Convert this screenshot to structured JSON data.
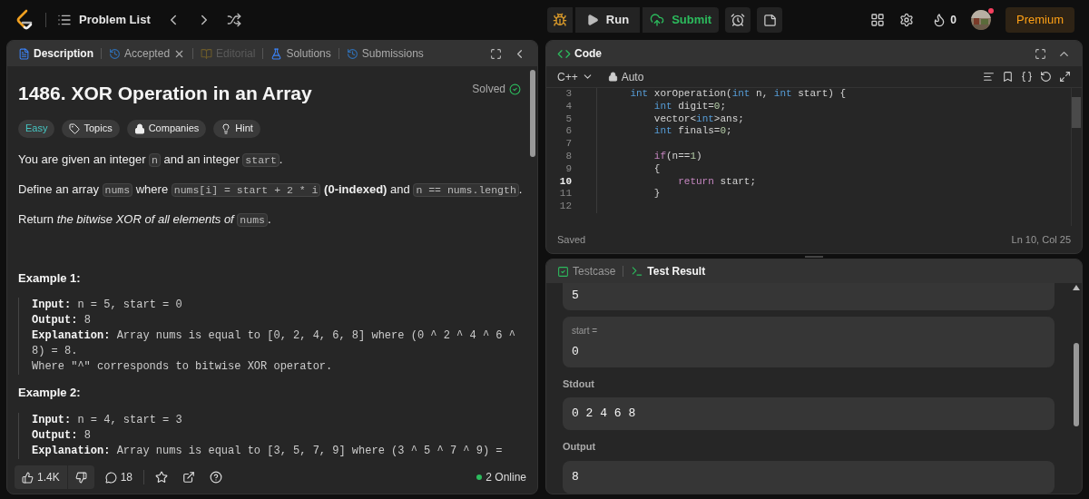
{
  "topbar": {
    "nav_label": "Problem List",
    "run": "Run",
    "submit": "Submit",
    "streak": "0",
    "notification": true,
    "premium": "Premium"
  },
  "left_panel": {
    "tabs": [
      {
        "label": "Description",
        "kind": "description",
        "selected": true,
        "disabled": false,
        "closable": false
      },
      {
        "label": "Accepted",
        "kind": "accepted",
        "selected": false,
        "disabled": false,
        "closable": true
      },
      {
        "label": "Editorial",
        "kind": "editorial",
        "selected": false,
        "disabled": true,
        "closable": false
      },
      {
        "label": "Solutions",
        "kind": "solutions",
        "selected": false,
        "disabled": false,
        "closable": false
      },
      {
        "label": "Submissions",
        "kind": "submissions",
        "selected": false,
        "disabled": false,
        "closable": false
      }
    ],
    "problem": {
      "title": "1486. XOR Operation in an Array",
      "status": "Solved",
      "tags": [
        {
          "kind": "difficulty",
          "label": "Easy"
        },
        {
          "kind": "topics",
          "label": "Topics"
        },
        {
          "kind": "companies",
          "label": "Companies"
        },
        {
          "kind": "hint",
          "label": "Hint"
        }
      ],
      "paragraphs": [
        [
          {
            "kind": "text",
            "text": "You are given an integer "
          },
          {
            "kind": "code",
            "text": "n"
          },
          {
            "kind": "text",
            "text": " and an integer "
          },
          {
            "kind": "code",
            "text": "start"
          },
          {
            "kind": "text",
            "text": "."
          }
        ],
        [
          {
            "kind": "text",
            "text": "Define an array "
          },
          {
            "kind": "code",
            "text": "nums"
          },
          {
            "kind": "text",
            "text": " where "
          },
          {
            "kind": "code",
            "text": "nums[i] = start + 2 * i"
          },
          {
            "kind": "text",
            "text": " **(0-indexed)** and "
          },
          {
            "kind": "code",
            "text": "n == nums.length"
          },
          {
            "kind": "text",
            "text": "."
          }
        ],
        [
          {
            "kind": "text",
            "text": "Return *the bitwise XOR of all elements of* "
          },
          {
            "kind": "code",
            "text": "nums"
          },
          {
            "kind": "text",
            "text": "."
          }
        ]
      ],
      "examples": [
        {
          "title": "Example 1:",
          "lines": [
            {
              "label": "Input:",
              "value": "n = 5, start = 0"
            },
            {
              "label": "Output:",
              "value": "8"
            },
            {
              "label": "Explanation:",
              "value": "Array nums is equal to [0, 2, 4, 6, 8] where (0 ^ 2 ^ 4 ^ 6 ^ 8) = 8."
            },
            {
              "value": "Where \"^\" corresponds to bitwise XOR operator."
            }
          ]
        },
        {
          "title": "Example 2:",
          "lines": [
            {
              "label": "Input:",
              "value": "n = 4, start = 3"
            },
            {
              "label": "Output:",
              "value": "8"
            },
            {
              "label": "Explanation:",
              "value": "Array nums is equal to [3, 5, 7, 9] where (3 ^ 5 ^ 7 ^ 9) ="
            }
          ]
        }
      ]
    },
    "footer": {
      "likes": "1.4K",
      "comments": "18",
      "online": "2 Online"
    }
  },
  "code_panel": {
    "title": "Code",
    "language": "C++",
    "mode": "Auto",
    "lines": [
      {
        "number": "3",
        "current": false,
        "tokens": [
          {
            "kind": "keyword",
            "text": "    int"
          },
          {
            "kind": "plain",
            "text": " xorOperation("
          },
          {
            "kind": "keyword",
            "text": "int"
          },
          {
            "kind": "plain",
            "text": " n, "
          },
          {
            "kind": "keyword",
            "text": "int"
          },
          {
            "kind": "plain",
            "text": " start) {"
          }
        ]
      },
      {
        "number": "4",
        "current": false,
        "tokens": [
          {
            "kind": "keyword",
            "text": "        int"
          },
          {
            "kind": "plain",
            "text": " digit="
          },
          {
            "kind": "number",
            "text": "0"
          },
          {
            "kind": "plain",
            "text": ";"
          }
        ]
      },
      {
        "number": "5",
        "current": false,
        "tokens": [
          {
            "kind": "plain",
            "text": "        vector<"
          },
          {
            "kind": "keyword",
            "text": "int"
          },
          {
            "kind": "plain",
            "text": ">ans;"
          }
        ]
      },
      {
        "number": "6",
        "current": false,
        "tokens": [
          {
            "kind": "keyword",
            "text": "        int"
          },
          {
            "kind": "plain",
            "text": " finals="
          },
          {
            "kind": "number",
            "text": "0"
          },
          {
            "kind": "plain",
            "text": ";"
          }
        ]
      },
      {
        "number": "7",
        "current": false
      },
      {
        "number": "8",
        "current": false,
        "tokens": [
          {
            "kind": "control",
            "text": "        if"
          },
          {
            "kind": "plain",
            "text": "(n=="
          },
          {
            "kind": "number",
            "text": "1"
          },
          {
            "kind": "plain",
            "text": ")"
          }
        ]
      },
      {
        "number": "9",
        "current": false,
        "tokens": [
          {
            "kind": "plain",
            "text": "        {"
          }
        ]
      },
      {
        "number": "10",
        "current": true,
        "tokens": [
          {
            "kind": "control",
            "text": "            return"
          },
          {
            "kind": "plain",
            "text": " start;"
          }
        ]
      },
      {
        "number": "11",
        "current": false,
        "tokens": [
          {
            "kind": "plain",
            "text": "        }"
          }
        ]
      },
      {
        "number": "12",
        "current": false
      }
    ],
    "status": "Saved",
    "cursor": "Ln 10, Col 25"
  },
  "result_panel": {
    "tabs": [
      {
        "label": "Testcase",
        "kind": "testcase",
        "selected": false
      },
      {
        "label": "Test Result",
        "kind": "result",
        "selected": true
      }
    ],
    "cut_value": "5",
    "inputs": [
      {
        "label": "start =",
        "value": "0"
      }
    ],
    "sections": [
      {
        "title": "Stdout",
        "value": "0 2 4 6 8"
      },
      {
        "title": "Output",
        "value": "8"
      }
    ]
  }
}
